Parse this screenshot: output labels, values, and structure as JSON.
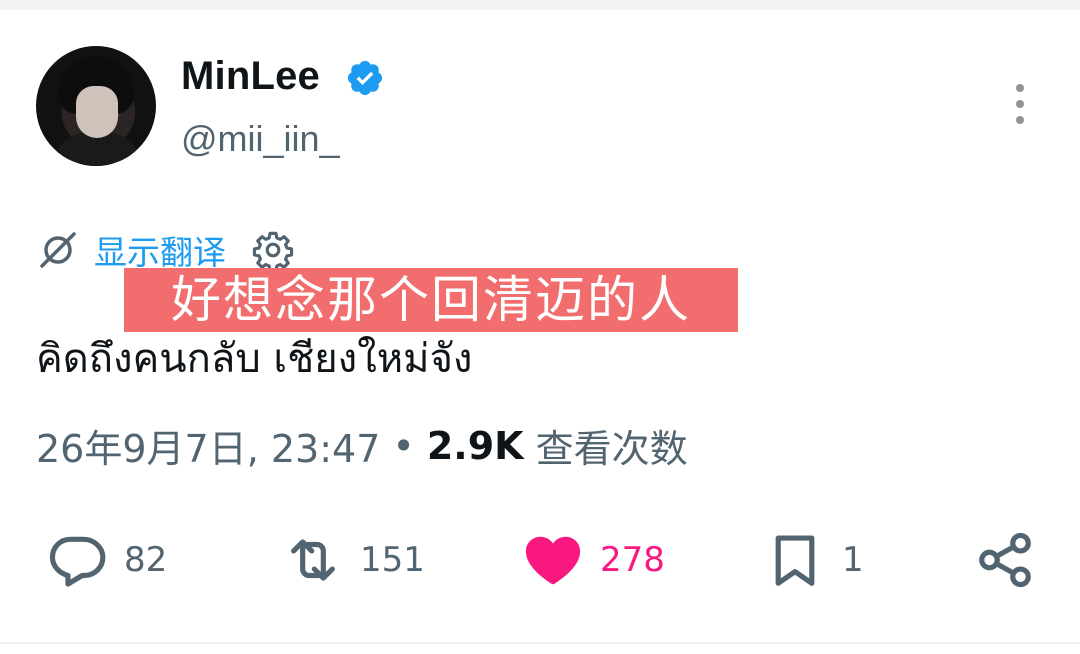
{
  "author": {
    "display_name": "MinLee",
    "handle": "@mii_iin_",
    "verified_icon": "verified-badge-icon",
    "verified_color": "#1d9bf0"
  },
  "translate": {
    "label": "显示翻译",
    "icon": "translate-icon",
    "settings_icon": "gear-icon"
  },
  "subtitle_overlay": {
    "text": "好想念那个回清迈的人",
    "background": "#f26d6d"
  },
  "tweet": {
    "text": "คิดถึงคนกลับ เชียงใหม่จัง"
  },
  "meta": {
    "date_time": "26年9月7日, 23:47",
    "separator": "•",
    "views_count": "2.9K",
    "views_label": "查看次数"
  },
  "actions": {
    "reply_count": "82",
    "retweet_count": "151",
    "like_count": "278",
    "bookmark_count": "1",
    "like_color": "#f91880"
  }
}
